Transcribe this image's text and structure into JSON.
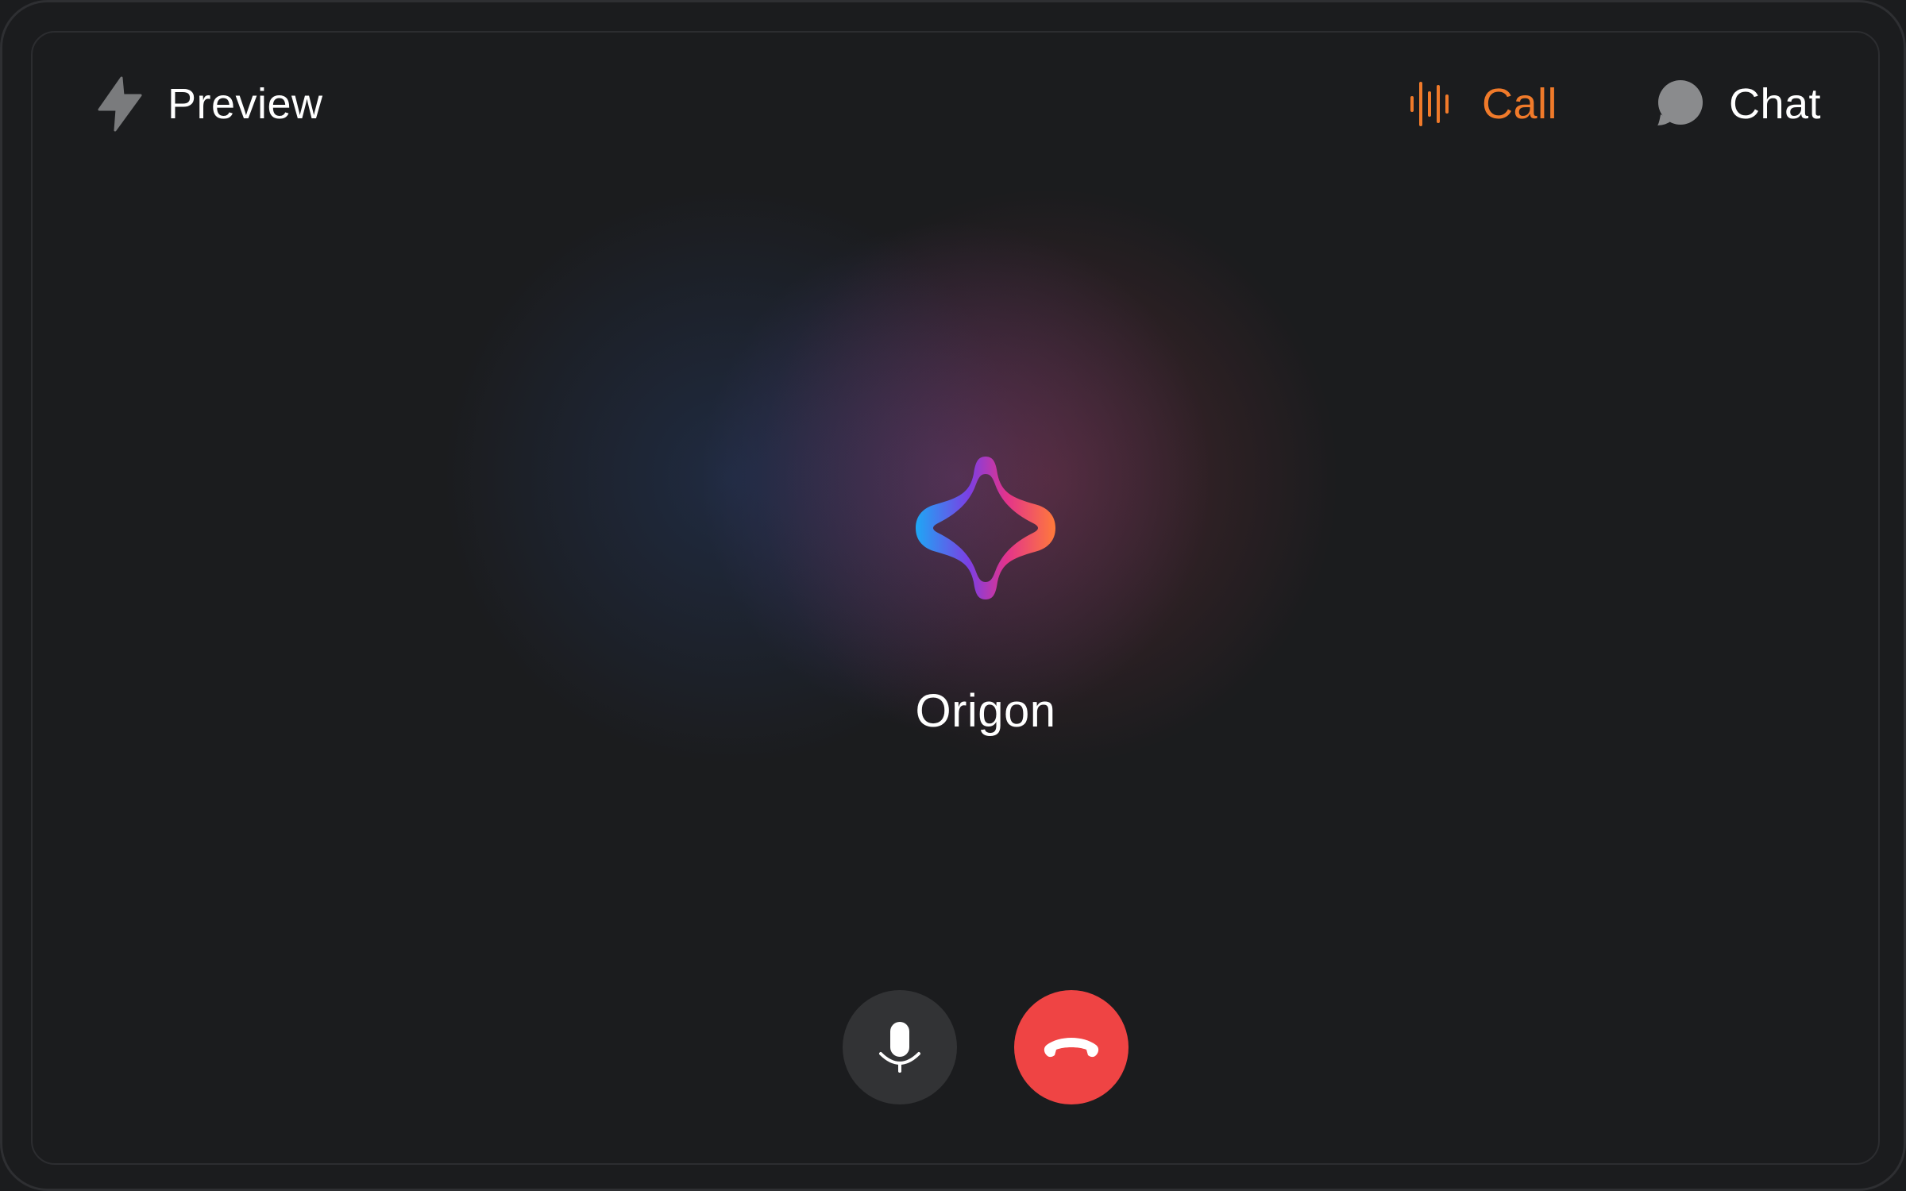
{
  "header": {
    "preview": {
      "label": "Preview",
      "icon": "lightning-bolt-icon"
    },
    "tabs": [
      {
        "label": "Call",
        "icon": "audio-waveform-icon",
        "active": true
      },
      {
        "label": "Chat",
        "icon": "chat-bubble-icon",
        "active": false
      }
    ]
  },
  "assistant": {
    "name": "Origon",
    "logo_icon": "sparkle-star-logo"
  },
  "controls": {
    "mic_icon": "microphone-icon",
    "hangup_icon": "hang-up-phone-icon"
  },
  "colors": {
    "background": "#1b1c1e",
    "accent": "#f07a2a",
    "hangup": "#ef4444",
    "mic_button": "#323335",
    "logo_gradient": [
      "#1ea7f5",
      "#7b3fe4",
      "#e3338c",
      "#ff7a3a"
    ]
  }
}
